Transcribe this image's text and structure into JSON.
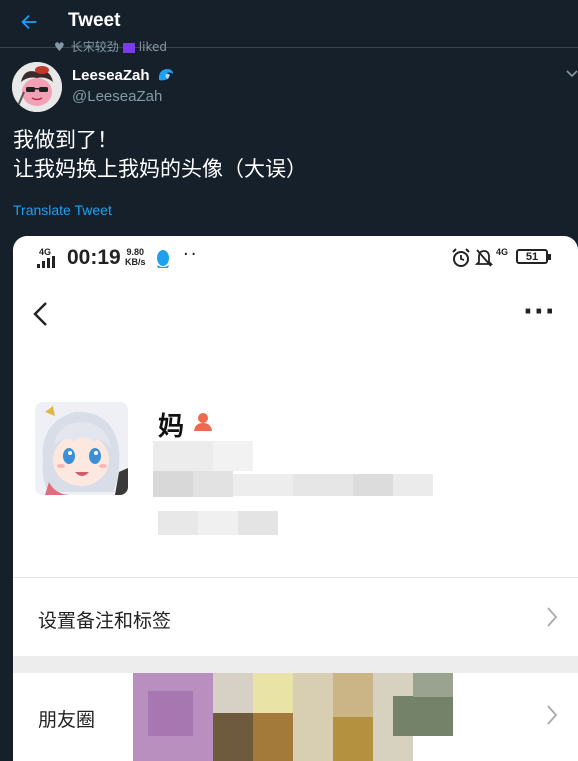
{
  "header": {
    "title": "Tweet"
  },
  "social_context": {
    "text": "长宋较劲",
    "suffix": "liked"
  },
  "tweet": {
    "author_name": "LeeseaZah",
    "author_handle": "@LeeseaZah",
    "text_line1": "我做到了！",
    "text_line2": "让我妈换上我妈的头像（大误）",
    "translate_label": "Translate Tweet"
  },
  "phone": {
    "network_label": "4G",
    "time": "00:19",
    "speed_value": "9.80",
    "speed_unit": "KB/s",
    "dots": "··",
    "network_label_right": "4G",
    "battery": "51",
    "more_label": "···",
    "contact_name": "妈",
    "row_remark_label": "设置备注和标签",
    "row_moments_label": "朋友圈"
  },
  "colors": {
    "background": "#15202b",
    "accent": "#1da1f2",
    "secondary_text": "#8899a6",
    "divider": "#38444d"
  }
}
